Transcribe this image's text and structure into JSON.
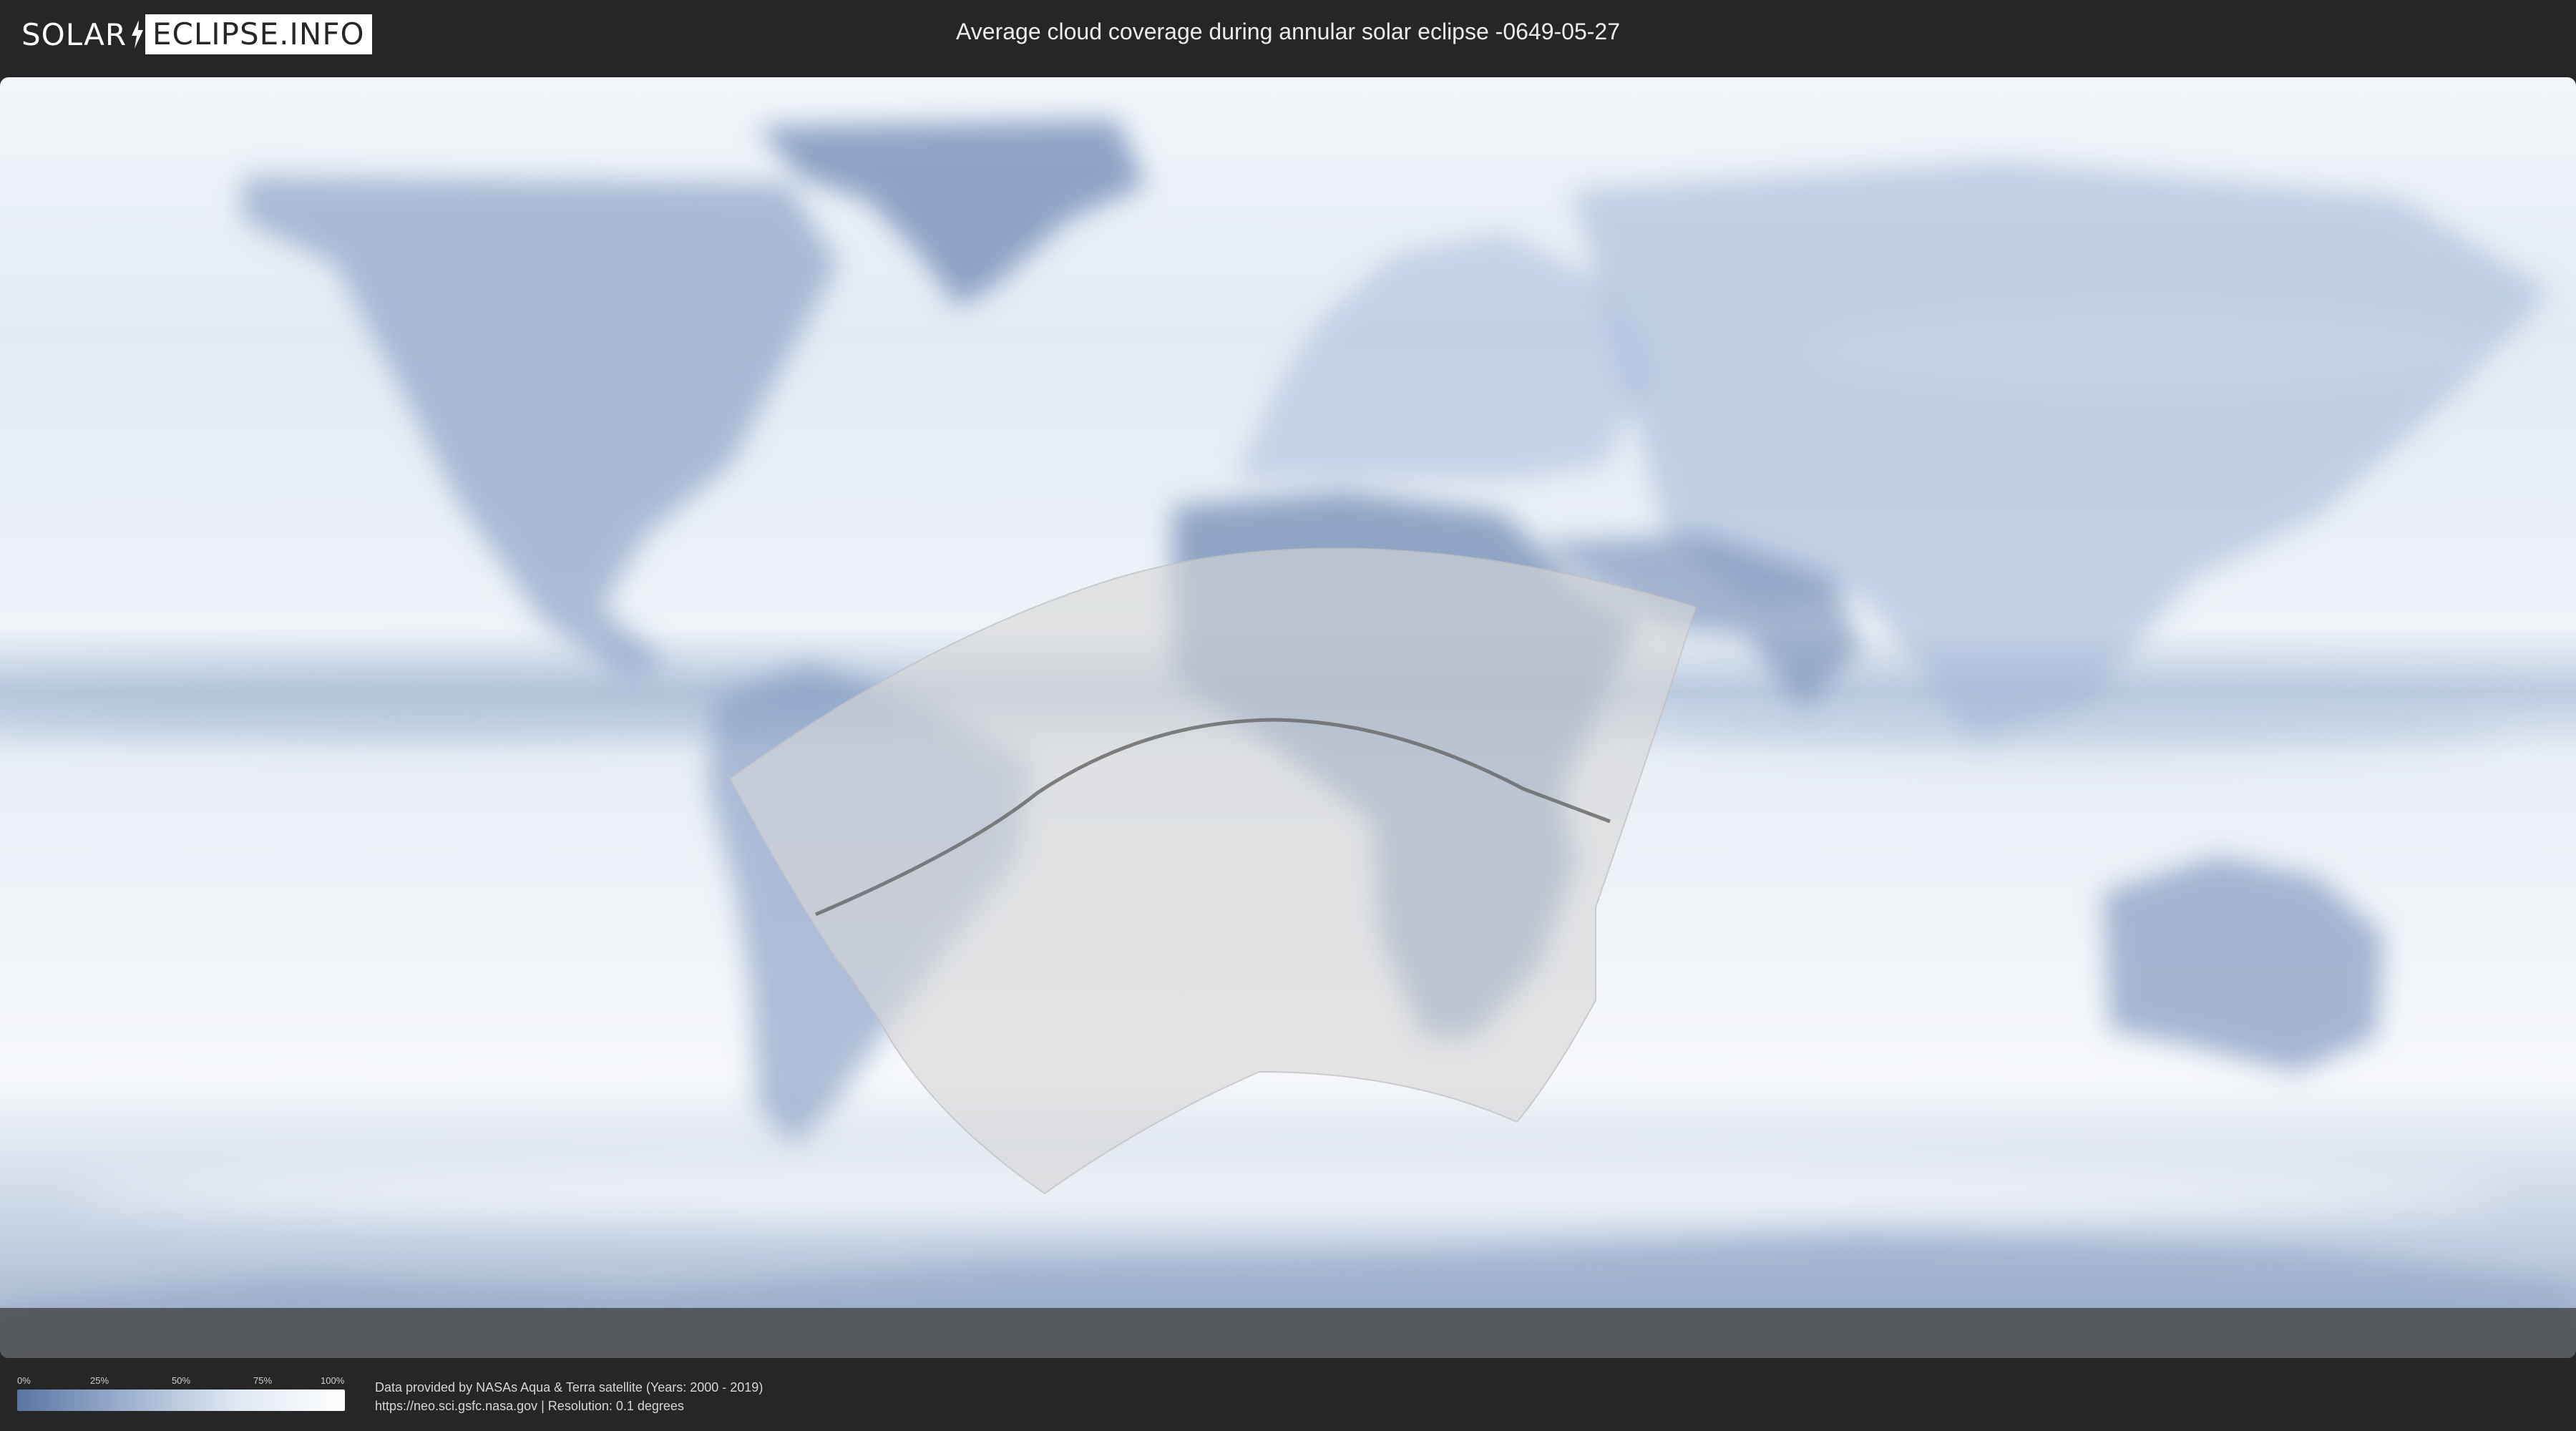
{
  "header": {
    "logo_part1": "SOLAR",
    "logo_part2": "ECLIPSE.INFO",
    "title": "Average cloud coverage during annular solar eclipse -0649-05-27"
  },
  "map": {
    "icons": [
      "world-map",
      "cloud-coverage-overlay",
      "eclipse-visibility-zone",
      "eclipse-central-path"
    ],
    "colors": {
      "ocean_cloud": "#e6edf5",
      "land_clear": "#7d96be",
      "eclipse_zone": "#d9d9d9",
      "central_path": "#6b6b6b"
    }
  },
  "footer": {
    "legend": {
      "ticks": [
        "0%",
        "25%",
        "50%",
        "75%",
        "100%"
      ],
      "gradient": [
        "#5a74a4",
        "#9db1cf",
        "#dfe8f2",
        "#ffffff"
      ]
    },
    "credit_line1": "Data provided by NASAs Aqua & Terra satellite (Years: 2000 - 2019)",
    "credit_line2": "https://neo.sci.gsfc.nasa.gov | Resolution: 0.1 degrees"
  }
}
